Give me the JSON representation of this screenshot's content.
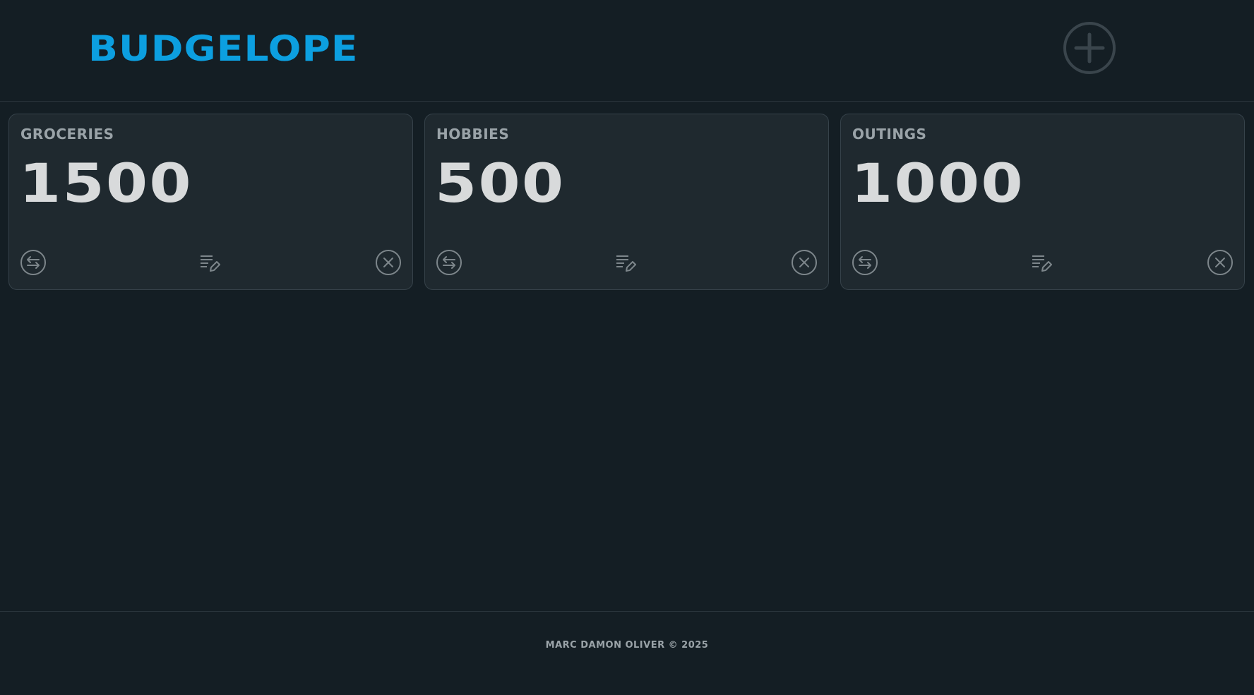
{
  "app": {
    "title": "BUDGELOPE",
    "add_icon": "plus-circle-icon"
  },
  "colors": {
    "background": "#141e24",
    "card_background": "#1f292f",
    "accent": "#0c9fe0",
    "muted_text": "#9aa3a8",
    "amount_text": "#d8dadb"
  },
  "budgets": [
    {
      "name": "GROCERIES",
      "amount": "1500"
    },
    {
      "name": "HOBBIES",
      "amount": "500"
    },
    {
      "name": "OUTINGS",
      "amount": "1000"
    }
  ],
  "card_actions": {
    "transfer_icon": "transfer-arrows-icon",
    "edit_icon": "edit-notes-icon",
    "delete_icon": "close-circle-icon"
  },
  "footer": {
    "text": "MARC DAMON OLIVER © 2025"
  }
}
